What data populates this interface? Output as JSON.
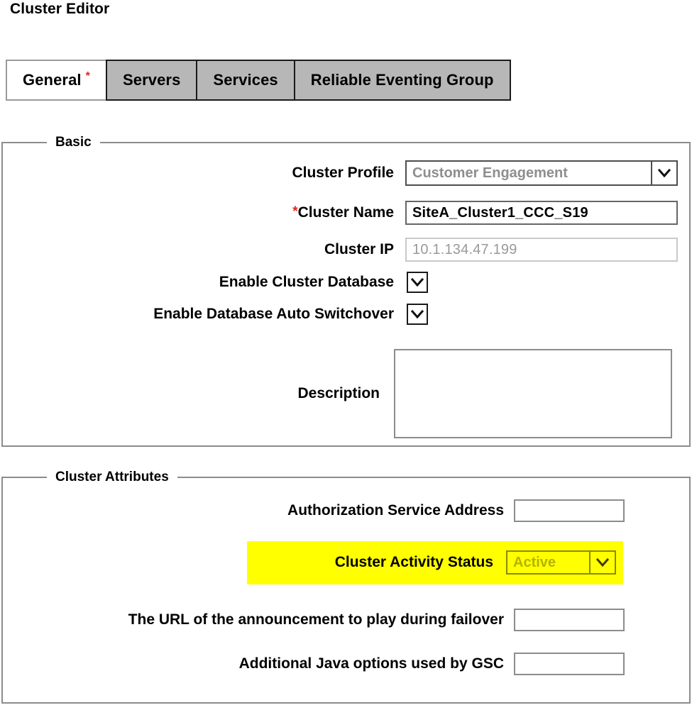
{
  "page": {
    "title": "Cluster Editor"
  },
  "tabs": [
    {
      "label": "General",
      "required_marker": "*",
      "active": true
    },
    {
      "label": "Servers",
      "required_marker": "",
      "active": false
    },
    {
      "label": "Services",
      "required_marker": "",
      "active": false
    },
    {
      "label": "Reliable Eventing Group",
      "required_marker": "",
      "active": false
    }
  ],
  "basic": {
    "legend": "Basic",
    "cluster_profile": {
      "label": "Cluster Profile",
      "value": "Customer Engagement",
      "arrow_icon": "chevron-down-icon"
    },
    "cluster_name": {
      "label": "Cluster Name",
      "required_marker": "*",
      "value": "SiteA_Cluster1_CCC_S19",
      "placeholder": ""
    },
    "cluster_ip": {
      "label": "Cluster IP",
      "value": "10.1.134.47.199",
      "placeholder": ""
    },
    "enable_cluster_database": {
      "label": "Enable Cluster Database",
      "checked": true,
      "icon": "check-icon"
    },
    "enable_database_auto_switchover": {
      "label": "Enable Database Auto Switchover",
      "checked": true,
      "icon": "check-icon"
    },
    "description": {
      "label": "Description",
      "value": "",
      "placeholder": ""
    }
  },
  "cluster_attributes": {
    "legend": "Cluster Attributes",
    "authorization_service_address": {
      "label": "Authorization Service Address",
      "value": "",
      "placeholder": ""
    },
    "cluster_activity_status": {
      "label": "Cluster Activity Status",
      "value": "Active",
      "arrow_icon": "chevron-down-icon",
      "highlighted": true
    },
    "announcement_url": {
      "label": "The URL of the announcement to play during failover",
      "value": "",
      "placeholder": ""
    },
    "additional_java_options": {
      "label": "Additional Java options used by GSC",
      "value": "",
      "placeholder": ""
    }
  },
  "colors": {
    "highlight": "#ffff00",
    "required": "#e8211c",
    "tab_inactive": "#b7b7b7",
    "tab_active": "#ffffff",
    "border": "#8c8c8c"
  }
}
